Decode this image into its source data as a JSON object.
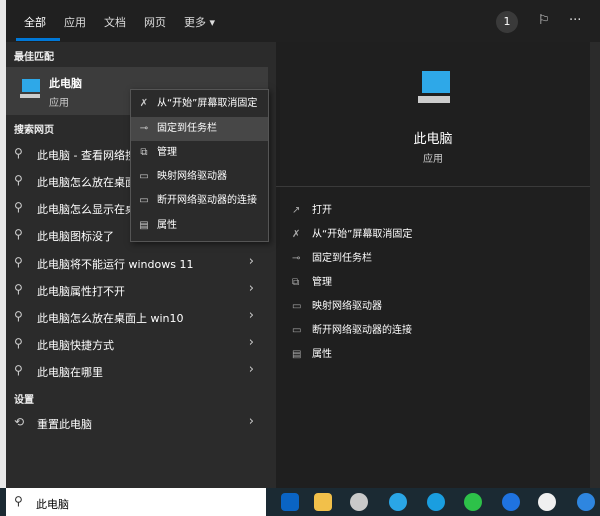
{
  "tabs": [
    "全部",
    "应用",
    "文档",
    "网页",
    "更多 ▾"
  ],
  "badge": "1",
  "best_match": {
    "section": "最佳匹配",
    "title": "此电脑",
    "subtitle": "应用"
  },
  "web_section": "搜索网页",
  "web_results": [
    "此电脑 - 查看网络搜",
    "此电脑怎么放在桌面",
    "此电脑怎么显示在桌",
    "此电脑图标没了",
    "此电脑将不能运行 windows 11",
    "此电脑属性打不开",
    "此电脑怎么放在桌面上 win10",
    "此电脑快捷方式",
    "此电脑在哪里"
  ],
  "settings_section": "设置",
  "settings_item": "重置此电脑",
  "context_menu": [
    "从“开始”屏幕取消固定",
    "固定到任务栏",
    "管理",
    "映射网络驱动器",
    "断开网络驱动器的连接",
    "属性"
  ],
  "preview": {
    "title": "此电脑",
    "subtitle": "应用",
    "actions": [
      "打开",
      "从“开始”屏幕取消固定",
      "固定到任务栏",
      "管理",
      "映射网络驱动器",
      "断开网络驱动器的连接",
      "属性"
    ]
  },
  "search": {
    "value": "此电脑"
  },
  "taskbar": [
    "outlook",
    "file-explorer",
    "snipping",
    "ie",
    "skype",
    "wechat",
    "app",
    "asus",
    "sogou"
  ]
}
